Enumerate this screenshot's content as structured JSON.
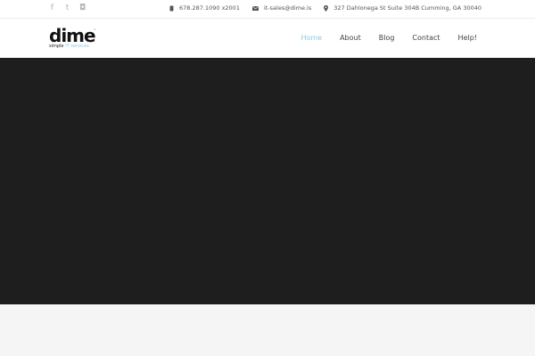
{
  "topbar": {
    "social": [
      {
        "icon": "facebook-icon",
        "glyph": "f"
      },
      {
        "icon": "twitter-icon",
        "glyph": "t"
      },
      {
        "icon": "instagram-icon",
        "glyph": "◘"
      }
    ],
    "phone": "678.287.1090 x2001",
    "email": "it-sales@dime.is",
    "address": "327 Dahlonega St Suite 304B Cumming, GA 30040"
  },
  "header": {
    "logo_text": "dime",
    "logo_tm": "™",
    "logo_tag_prefix": "simple",
    "logo_tag_highlight": " IT services"
  },
  "nav": {
    "items": [
      {
        "label": "Home",
        "active": true
      },
      {
        "label": "About",
        "active": false
      },
      {
        "label": "Blog",
        "active": false
      },
      {
        "label": "Contact",
        "active": false
      },
      {
        "label": "Help!",
        "active": false
      }
    ]
  },
  "colors": {
    "accent": "#8ccbe0",
    "hero_bg": "#1e1e1e",
    "page_bg": "#f5f5f5"
  }
}
